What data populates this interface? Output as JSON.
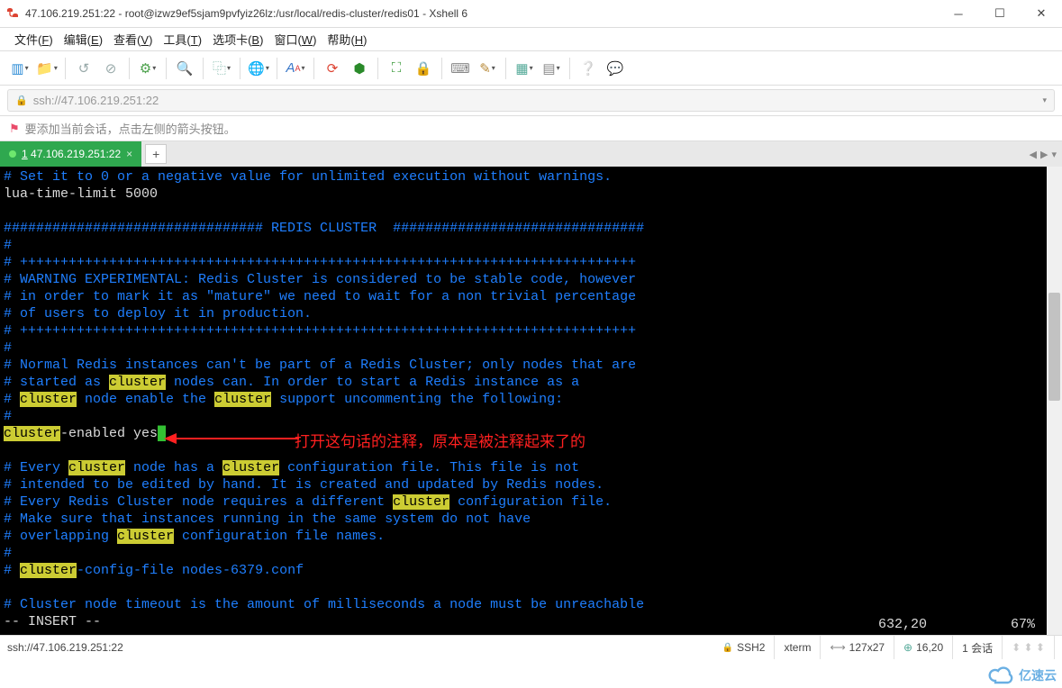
{
  "title": "47.106.219.251:22 - root@izwz9ef5sjam9pvfyiz26lz:/usr/local/redis-cluster/redis01 - Xshell 6",
  "menubar": {
    "file": {
      "label": "文件",
      "key": "F"
    },
    "edit": {
      "label": "编辑",
      "key": "E"
    },
    "view": {
      "label": "查看",
      "key": "V"
    },
    "tools": {
      "label": "工具",
      "key": "T"
    },
    "tabs": {
      "label": "选项卡",
      "key": "B"
    },
    "window": {
      "label": "窗口",
      "key": "W"
    },
    "help": {
      "label": "帮助",
      "key": "H"
    }
  },
  "address": {
    "url": "ssh://47.106.219.251:22"
  },
  "hint": "要添加当前会话，点击左侧的箭头按钮。",
  "tab": {
    "num": "1",
    "label": "47.106.219.251:22"
  },
  "terminal": {
    "l01_a": "# Set it to 0 or a negative value for unlimited execution without warnings.",
    "l02_a": "lua-time-limit 5000",
    "l04_a": "################################ REDIS CLUSTER  ###############################",
    "l05_a": "#",
    "l06_a": "# ++++++++++++++++++++++++++++++++++++++++++++++++++++++++++++++++++++++++++++",
    "l07_a": "# WARNING EXPERIMENTAL: Redis Cluster is considered to be stable code, however",
    "l08_a": "# in order to mark it as \"mature\" we need to wait for a non trivial percentage",
    "l09_a": "# of users to deploy it in production.",
    "l10_a": "# ++++++++++++++++++++++++++++++++++++++++++++++++++++++++++++++++++++++++++++",
    "l11_a": "#",
    "l12_a": "# Normal Redis instances can't be part of a Redis Cluster; only nodes that are",
    "l13_a": "# started as ",
    "l13_hl": "cluster",
    "l13_b": " nodes can. In order to start a Redis instance as a",
    "l14_a": "# ",
    "l14_hl": "cluster",
    "l14_b": " node enable the ",
    "l14_hl2": "cluster",
    "l14_c": " support uncommenting the following:",
    "l15_a": "#",
    "l16_hl": "cluster",
    "l16_a": "-enabled yes",
    "l18_a": "# Every ",
    "l18_hl": "cluster",
    "l18_b": " node has a ",
    "l18_hl2": "cluster",
    "l18_c": " configuration file. This file is not",
    "l19_a": "# intended to be edited by hand. It is created and updated by Redis nodes.",
    "l20_a": "# Every Redis Cluster node requires a different ",
    "l20_hl": "cluster",
    "l20_b": " configuration file.",
    "l21_a": "# Make sure that instances running in the same system do not have",
    "l22_a": "# overlapping ",
    "l22_hl": "cluster",
    "l22_b": " configuration file names.",
    "l23_a": "#",
    "l24_a": "# ",
    "l24_hl": "cluster",
    "l24_b": "-config-file nodes-6379.conf",
    "l26_a": "# Cluster node timeout is the amount of milliseconds a node must be unreachable",
    "status_mode": "-- INSERT --",
    "status_pos": "632,20",
    "status_pct": "67%"
  },
  "annotation": "打开这句话的注释，原本是被注释起来了的",
  "statusbar": {
    "addr": "ssh://47.106.219.251:22",
    "proto": "SSH2",
    "term": "xterm",
    "size": "127x27",
    "cursor": "16,20",
    "sessions": "1 会话"
  },
  "watermark": "亿速云"
}
